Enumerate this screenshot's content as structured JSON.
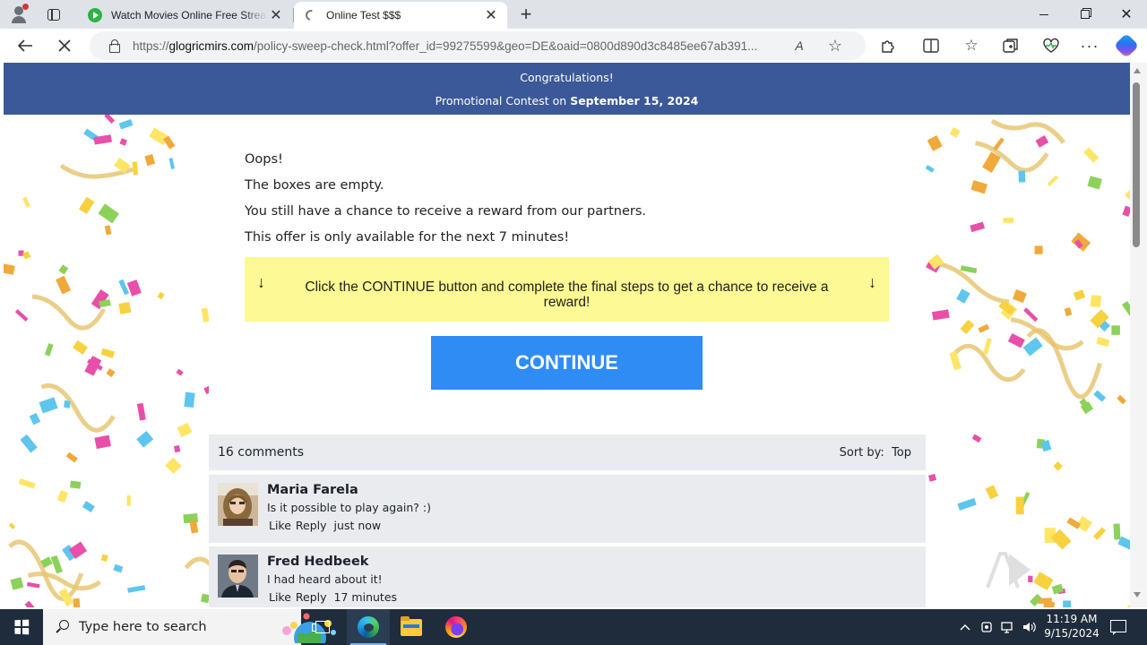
{
  "browser": {
    "tabs": [
      {
        "title": "Watch Movies Online Free Stream",
        "active": false
      },
      {
        "title": "Online Test $$$",
        "active": true
      }
    ],
    "new_tab_label": "+",
    "close_glyph": "✕",
    "address": {
      "scheme": "https://",
      "host": "glogricmirs.com",
      "path": "/policy-sweep-check.html?offer_id=99275599&geo=DE&oaid=0800d890d3c8485ee67ab391..."
    },
    "read_aloud_label": "A",
    "icons": {
      "back": "arrow-left-icon",
      "stop": "close-icon",
      "lock": "lock-icon",
      "favorite": "star-icon",
      "extensions": "puzzle-icon",
      "split_screen": "split-screen-icon",
      "favorites": "favorites-icon",
      "collections": "collections-icon",
      "performance": "heart-pulse-icon",
      "more": "ellipsis-icon",
      "copilot": "copilot-icon"
    }
  },
  "page": {
    "header": {
      "line1": "Congratulations!",
      "line2_prefix": "Promotional Contest on",
      "line2_date": "September 15, 2024"
    },
    "messages": {
      "oops": "Oops!",
      "empty": "The boxes are empty.",
      "chance": "You still have a chance to receive a reward from our partners.",
      "offer": "This offer is only available for the next 7 minutes!"
    },
    "notice": {
      "text": "Click the CONTINUE button and complete the final steps to get a chance to receive a reward!",
      "arrow": "↓",
      "background": "#fdf994"
    },
    "continue_label": "CONTINUE",
    "comments": {
      "count_label": "16 comments",
      "sort_label": "Sort by:",
      "sort_value": "Top",
      "items": [
        {
          "name": "Maria Farela",
          "text": "Is it possible to play again? :)",
          "like": "Like",
          "reply": "Reply",
          "time": "just now"
        },
        {
          "name": "Fred Hedbeek",
          "text": "I had heard about it!",
          "like": "Like",
          "reply": "Reply",
          "time": "17 minutes"
        }
      ]
    },
    "colors": {
      "header_band": "#3b5998",
      "button": "#2f8cf5",
      "comments_bg": "#e9ebee"
    }
  },
  "taskbar": {
    "search_placeholder": "Type here to search",
    "clock_time": "11:19 AM",
    "clock_date": "9/15/2024",
    "tray_chevron": "^",
    "icons": [
      "windows-start-icon",
      "search-icon",
      "task-view-icon",
      "edge-icon",
      "file-explorer-icon",
      "firefox-icon",
      "network-icon",
      "volume-icon",
      "notification-icon"
    ]
  }
}
